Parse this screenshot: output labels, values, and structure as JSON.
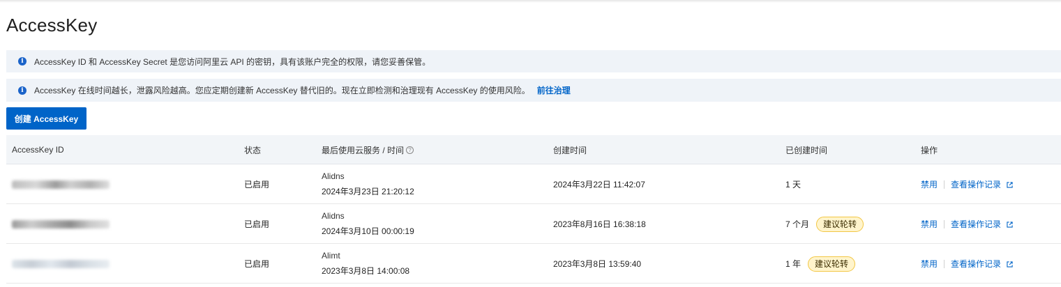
{
  "page": {
    "title": "AccessKey"
  },
  "notices": [
    {
      "text": "AccessKey ID 和 AccessKey Secret 是您访问阿里云 API 的密钥，具有该账户完全的权限，请您妥善保管。",
      "link": ""
    },
    {
      "text": "AccessKey 在线时间越长，泄露风险越高。您应定期创建新 AccessKey 替代旧的。现在立即检测和治理现有 AccessKey 的使用风险。",
      "link": "前往治理"
    }
  ],
  "toolbar": {
    "create_label": "创建 AccessKey"
  },
  "table": {
    "headers": {
      "id": "AccessKey ID",
      "status": "状态",
      "last_used": "最后使用云服务 / 时间",
      "created": "创建时间",
      "age": "已创建时间",
      "actions": "操作"
    },
    "rows": [
      {
        "status": "已启用",
        "service": "Alidns",
        "last_used": "2024年3月23日 21:20:12",
        "created": "2024年3月22日 11:42:07",
        "age": "1 天",
        "badge": "",
        "disable": "禁用",
        "logs": "查看操作记录"
      },
      {
        "status": "已启用",
        "service": "Alidns",
        "last_used": "2024年3月10日 00:00:19",
        "created": "2023年8月16日 16:38:18",
        "age": "7 个月",
        "badge": "建议轮转",
        "disable": "禁用",
        "logs": "查看操作记录"
      },
      {
        "status": "已启用",
        "service": "Alimt",
        "last_used": "2023年3月8日 14:00:08",
        "created": "2023年3月8日 13:59:40",
        "age": "1 年",
        "badge": "建议轮转",
        "disable": "禁用",
        "logs": "查看操作记录"
      }
    ]
  },
  "colors": {
    "primary": "#0064c8",
    "notice_bg": "#eff3f8",
    "badge_bg": "#fff4cc",
    "badge_border": "#f2c744"
  },
  "icons": {
    "info": "info-icon",
    "help": "question-circle-icon",
    "external": "external-link-icon"
  }
}
